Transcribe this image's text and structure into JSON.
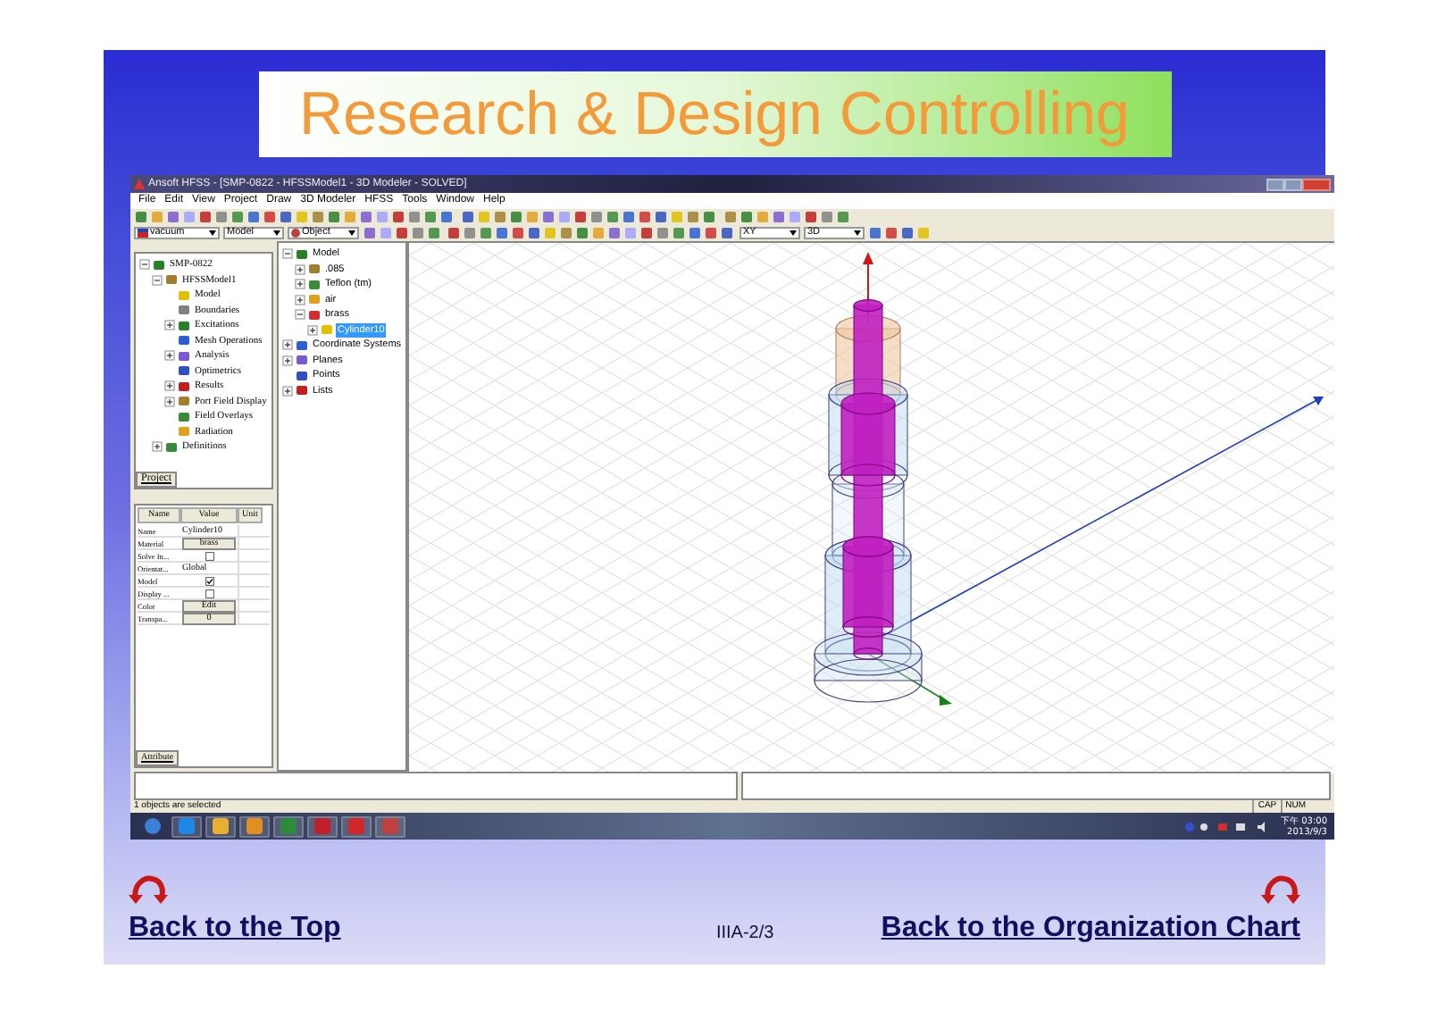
{
  "slide": {
    "title": "Research & Design Controlling",
    "page_number": "IIIA-2/3",
    "nav_links": [
      {
        "label": "Back to the Top"
      },
      {
        "label": "Back to the Organization Chart"
      }
    ]
  },
  "app": {
    "window_title": "Ansoft HFSS - [SMP-0822 - HFSSModel1 - 3D Modeler - SOLVED]",
    "menu": [
      "File",
      "Edit",
      "View",
      "Project",
      "Draw",
      "3D Modeler",
      "HFSS",
      "Tools",
      "Window",
      "Help"
    ],
    "toolbar_dropdowns": [
      {
        "value": "vacuum",
        "kind": "material"
      },
      {
        "value": "Model",
        "kind": "plain"
      },
      {
        "value": "Object",
        "kind": "icon"
      },
      {
        "value": "XY",
        "kind": "plain"
      },
      {
        "value": "3D",
        "kind": "plain"
      }
    ],
    "project_tree": [
      {
        "label": "SMP-0822",
        "expanded": true,
        "selected": false,
        "children": [
          {
            "label": "HFSSModel1",
            "expanded": true,
            "selected": false,
            "children": [
              {
                "label": "Model",
                "selected": false
              },
              {
                "label": "Boundaries",
                "selected": false
              },
              {
                "label": "Excitations",
                "expanded": false,
                "selected": false
              },
              {
                "label": "Mesh Operations",
                "selected": false
              },
              {
                "label": "Analysis",
                "expanded": false,
                "selected": false
              },
              {
                "label": "Optimetrics",
                "selected": false
              },
              {
                "label": "Results",
                "expanded": false,
                "selected": false
              },
              {
                "label": "Port Field Display",
                "expanded": false,
                "selected": false
              },
              {
                "label": "Field Overlays",
                "selected": false
              },
              {
                "label": "Radiation",
                "selected": false
              }
            ]
          },
          {
            "label": "Definitions",
            "expanded": false,
            "selected": false
          }
        ]
      }
    ],
    "project_tab": "Project",
    "properties": {
      "columns": [
        "Name",
        "Value",
        "Unit"
      ],
      "rows": [
        {
          "name": "Name",
          "kind": "text",
          "value": "Cylinder10"
        },
        {
          "name": "Material",
          "kind": "button",
          "value": "brass"
        },
        {
          "name": "Solve In...",
          "kind": "checkbox",
          "checked": false
        },
        {
          "name": "Orientat...",
          "kind": "text",
          "value": "Global"
        },
        {
          "name": "Model",
          "kind": "checkbox",
          "checked": true
        },
        {
          "name": "Display ...",
          "kind": "checkbox",
          "checked": false
        },
        {
          "name": "Color",
          "kind": "button",
          "value": "Edit"
        },
        {
          "name": "Transpa...",
          "kind": "button",
          "value": "0"
        }
      ]
    },
    "attribute_tab": "Attribute",
    "model_tree": [
      {
        "label": "Model",
        "expanded": true,
        "selected": false,
        "children": [
          {
            "label": ".085",
            "expanded": false,
            "selected": false
          },
          {
            "label": "Teflon (tm)",
            "expanded": false,
            "selected": false
          },
          {
            "label": "air",
            "expanded": false,
            "selected": false
          },
          {
            "label": "brass",
            "expanded": true,
            "selected": false,
            "children": [
              {
                "label": "Cylinder10",
                "expanded": false,
                "selected": true
              }
            ]
          }
        ]
      },
      {
        "label": "Coordinate Systems",
        "expanded": false,
        "selected": false
      },
      {
        "label": "Planes",
        "expanded": false,
        "selected": false
      },
      {
        "label": "Points",
        "selected": false
      },
      {
        "label": "Lists",
        "expanded": false,
        "selected": false
      }
    ],
    "status_text": "1 objects are selected",
    "status_indicators": [
      "CAP",
      "NUM"
    ]
  },
  "taskbar": {
    "clock_time": "下午 03:00",
    "clock_date": "2013/9/3"
  }
}
